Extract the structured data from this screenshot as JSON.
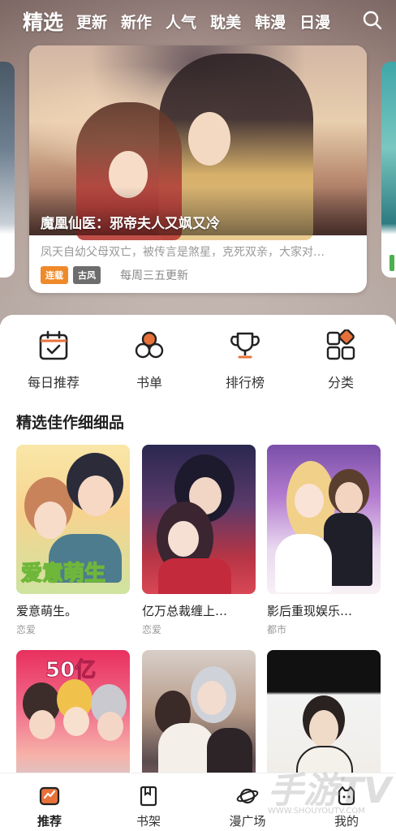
{
  "top_tabs": [
    "精选",
    "更新",
    "新作",
    "人气",
    "耽美",
    "韩漫",
    "日漫"
  ],
  "banner": {
    "title": "魔凰仙医：邪帝夫人又飒又冷",
    "description": "凤天自幼父母双亡，被传言是煞星，克死双亲，大家对…",
    "tags": [
      "连载",
      "古风"
    ],
    "update": "每周三五更新"
  },
  "quick_links": [
    {
      "label": "每日推荐",
      "icon": "calendar-check-icon"
    },
    {
      "label": "书单",
      "icon": "circles-icon"
    },
    {
      "label": "排行榜",
      "icon": "trophy-icon"
    },
    {
      "label": "分类",
      "icon": "category-grid-icon"
    }
  ],
  "section_title": "精选佳作细细品",
  "comics": [
    {
      "name": "爱意萌生。",
      "genre": "恋爱",
      "cover_text": "爱意萌生"
    },
    {
      "name": "亿万总裁缠上…",
      "genre": "恋爱",
      "cover_text": ""
    },
    {
      "name": "影后重现娱乐…",
      "genre": "都市",
      "cover_text": ""
    },
    {
      "name": "",
      "genre": "",
      "cover_text": "50亿"
    },
    {
      "name": "",
      "genre": "",
      "cover_text": ""
    },
    {
      "name": "",
      "genre": "",
      "cover_text": ""
    }
  ],
  "bottom_nav": [
    {
      "label": "推荐",
      "icon": "recommend-icon",
      "active": true
    },
    {
      "label": "书架",
      "icon": "bookshelf-icon",
      "active": false
    },
    {
      "label": "漫广场",
      "icon": "planet-icon",
      "active": false
    },
    {
      "label": "我的",
      "icon": "profile-icon",
      "active": false
    }
  ],
  "watermark": {
    "text": "手游TV",
    "url": "WWW.SHOUYOUTV.COM"
  },
  "colors": {
    "accent": "#ef8a2a",
    "tag_gray": "#6d6d6d",
    "icon_orange": "#e8713a"
  }
}
